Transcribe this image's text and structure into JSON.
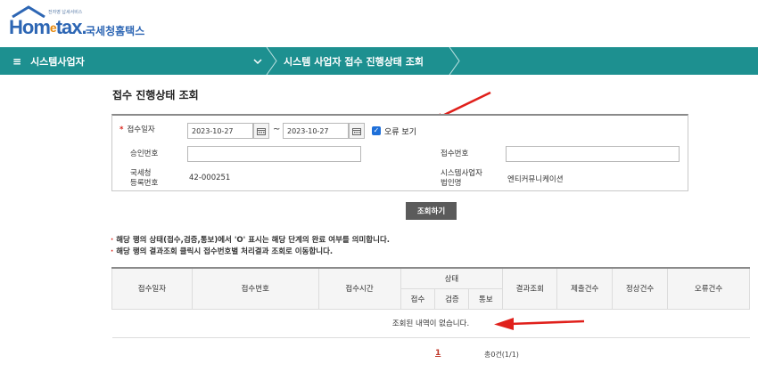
{
  "header": {
    "tagline": "전자영 납세서비스",
    "brand_prefix": "Hom",
    "brand_e": "e",
    "brand_suffix": "tax.",
    "brand_ko": "국세청홈택스"
  },
  "nav": {
    "menu_label": "시스템사업자",
    "current_page": "시스템 사업자 접수 진행상태 조회"
  },
  "page": {
    "title": "접수 진행상태 조회"
  },
  "form": {
    "receipt_date_label": "접수일자",
    "required_mark": "*",
    "start_date": "2023-10-27",
    "end_date": "2023-10-27",
    "tilde": "~",
    "show_errors_label": "오류 보기",
    "show_errors_checked": true,
    "approval_no_label": "승인번호",
    "approval_no_value": "",
    "receipt_no_label": "접수번호",
    "receipt_no_value": "",
    "nts_reg_no_label_1": "국세청",
    "nts_reg_no_label_2": "등록번호",
    "nts_reg_no_value": "42-000251",
    "sys_corp_name_label_1": "시스템사업자",
    "sys_corp_name_label_2": "법인명",
    "sys_corp_name_value": "엔티커뮤니케이션",
    "search_label": "조회하기"
  },
  "notes": [
    "해당 행의 상태(접수,검증,통보)에서 'O' 표시는 해당 단계의 완료 여부를 의미합니다.",
    "해당 행의 결과조회 클릭시 접수번호별 처리결과 조회로 이동합니다."
  ],
  "note_bullet": "·",
  "table": {
    "headers": {
      "receipt_date": "접수일자",
      "receipt_no": "접수번호",
      "receipt_time": "접수시간",
      "status": "상태",
      "status_receipt": "접수",
      "status_verify": "검증",
      "status_notify": "통보",
      "result": "결과조회",
      "submitted_count": "제출건수",
      "normal_count": "정상건수",
      "error_count": "오류건수"
    },
    "empty_message": "조회된 내역이 없습니다."
  },
  "pagination": {
    "current_page": "1",
    "summary": "총0건(1/1)"
  },
  "colors": {
    "nav_bg": "#1d9090",
    "brand_blue": "#2d66b4",
    "brand_orange": "#e8890c",
    "arrow_red": "#e0201b",
    "button_bg": "#5b5b5b"
  },
  "icons": {
    "menu": "hamburger-icon",
    "dropdown": "chevron-down-icon",
    "calendar": "calendar-icon",
    "annotation": "red-arrow-icon"
  }
}
